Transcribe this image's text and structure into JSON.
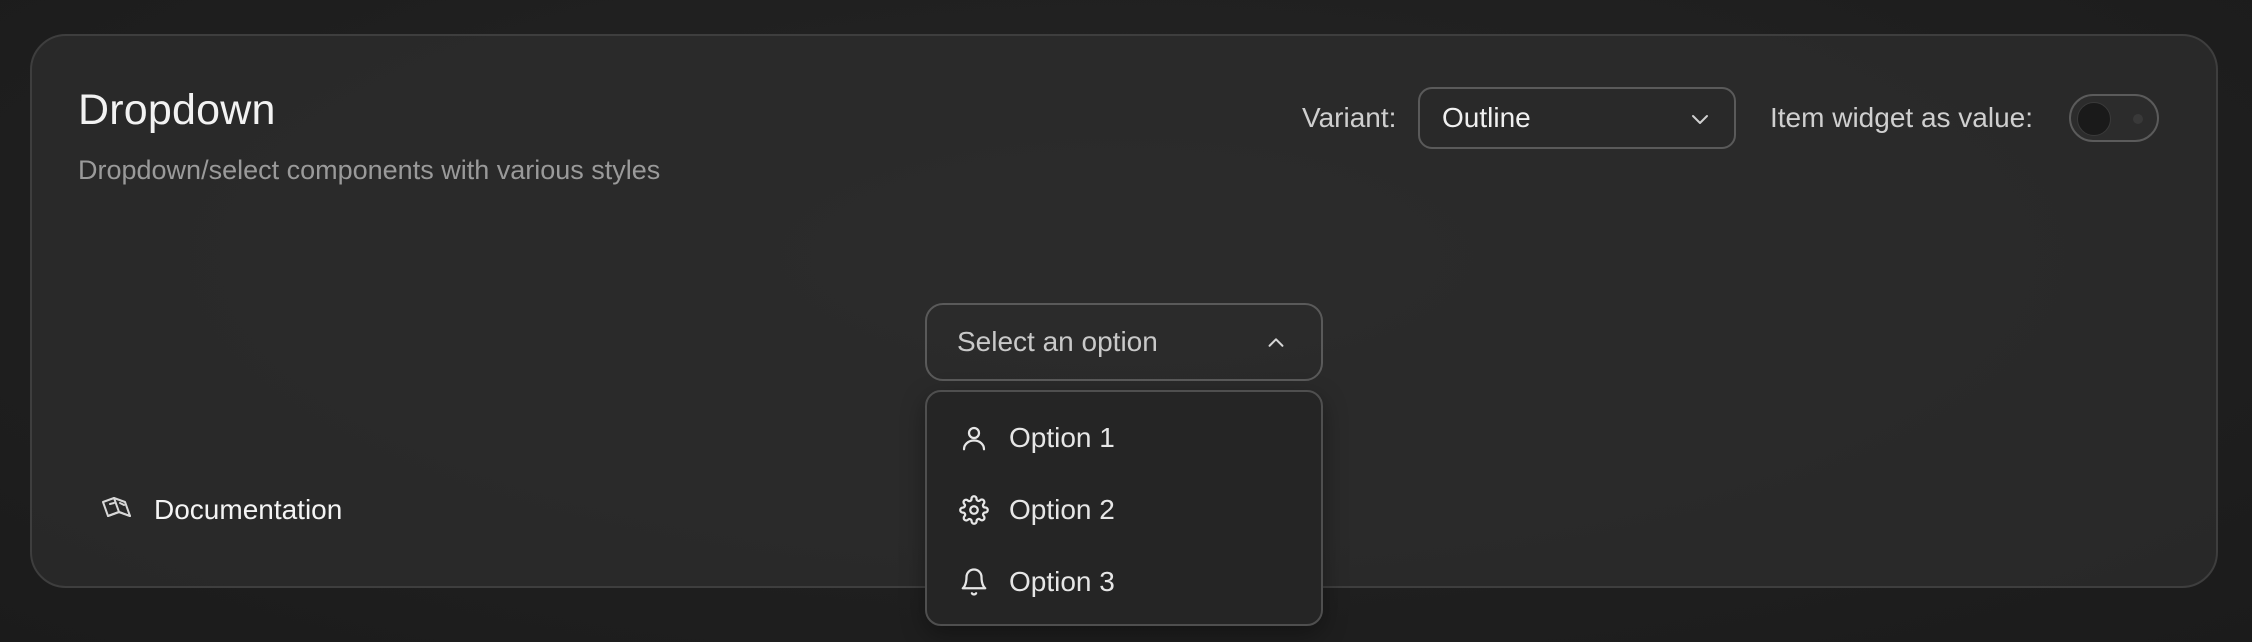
{
  "header": {
    "title": "Dropdown",
    "subtitle": "Dropdown/select components with various styles"
  },
  "controls": {
    "variant_label": "Variant:",
    "variant_value": "Outline",
    "item_widget_label": "Item widget as value:",
    "item_widget_enabled": false
  },
  "dropdown": {
    "placeholder": "Select an option",
    "expanded": true,
    "options": [
      {
        "label": "Option 1",
        "icon": "user-icon"
      },
      {
        "label": "Option 2",
        "icon": "gear-icon"
      },
      {
        "label": "Option 3",
        "icon": "bell-icon"
      }
    ]
  },
  "footer": {
    "doc_label": "Documentation",
    "doc_icon": "book-open-icon"
  },
  "colors": {
    "background": "#1f1f1f",
    "card": "#2e2e2e",
    "border": "#5a5a5a",
    "text": "#ececec",
    "muted": "#9a9a9a"
  }
}
